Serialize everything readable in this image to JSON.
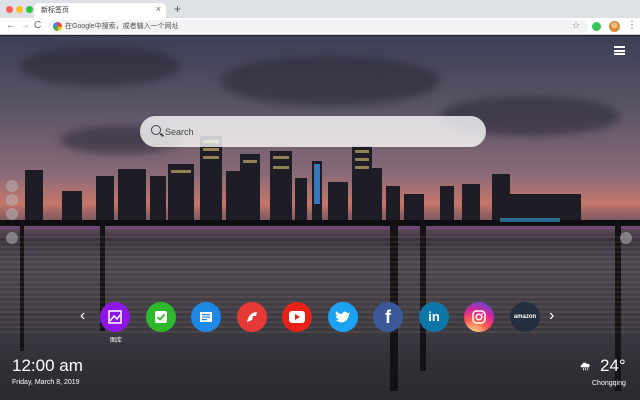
{
  "browser": {
    "tab_title": "新标签页",
    "tab_close": "×",
    "new_tab": "+",
    "omnibox_placeholder": "在Google中搜索，或者输入一个网址",
    "nav": {
      "back": "←",
      "forward": "→",
      "reload": "C"
    }
  },
  "search": {
    "placeholder": "Search"
  },
  "shortcuts": {
    "label_first": "图库",
    "items": [
      {
        "icon": "gallery-icon",
        "color": "#8e16e8"
      },
      {
        "icon": "check-icon",
        "color": "#2db82d"
      },
      {
        "icon": "notes-icon",
        "color": "#1e88e5"
      },
      {
        "icon": "game-icon",
        "color": "#e53935"
      },
      {
        "icon": "youtube-icon",
        "color": "#e62117"
      },
      {
        "icon": "twitter-icon",
        "color": "#1da1f2"
      },
      {
        "icon": "facebook-icon",
        "color": "#3b5998"
      },
      {
        "icon": "linkedin-icon",
        "color": "#0e76a8"
      },
      {
        "icon": "instagram-icon",
        "color": "#d6249f"
      },
      {
        "icon": "amazon-icon",
        "color": "#232f3e",
        "text": "amazon"
      }
    ]
  },
  "clock": {
    "time": "12:00 am",
    "date": "Friday, March 8, 2019"
  },
  "weather": {
    "temp": "24°",
    "city": "Chongqing",
    "icon": "cloud-rain-icon"
  }
}
